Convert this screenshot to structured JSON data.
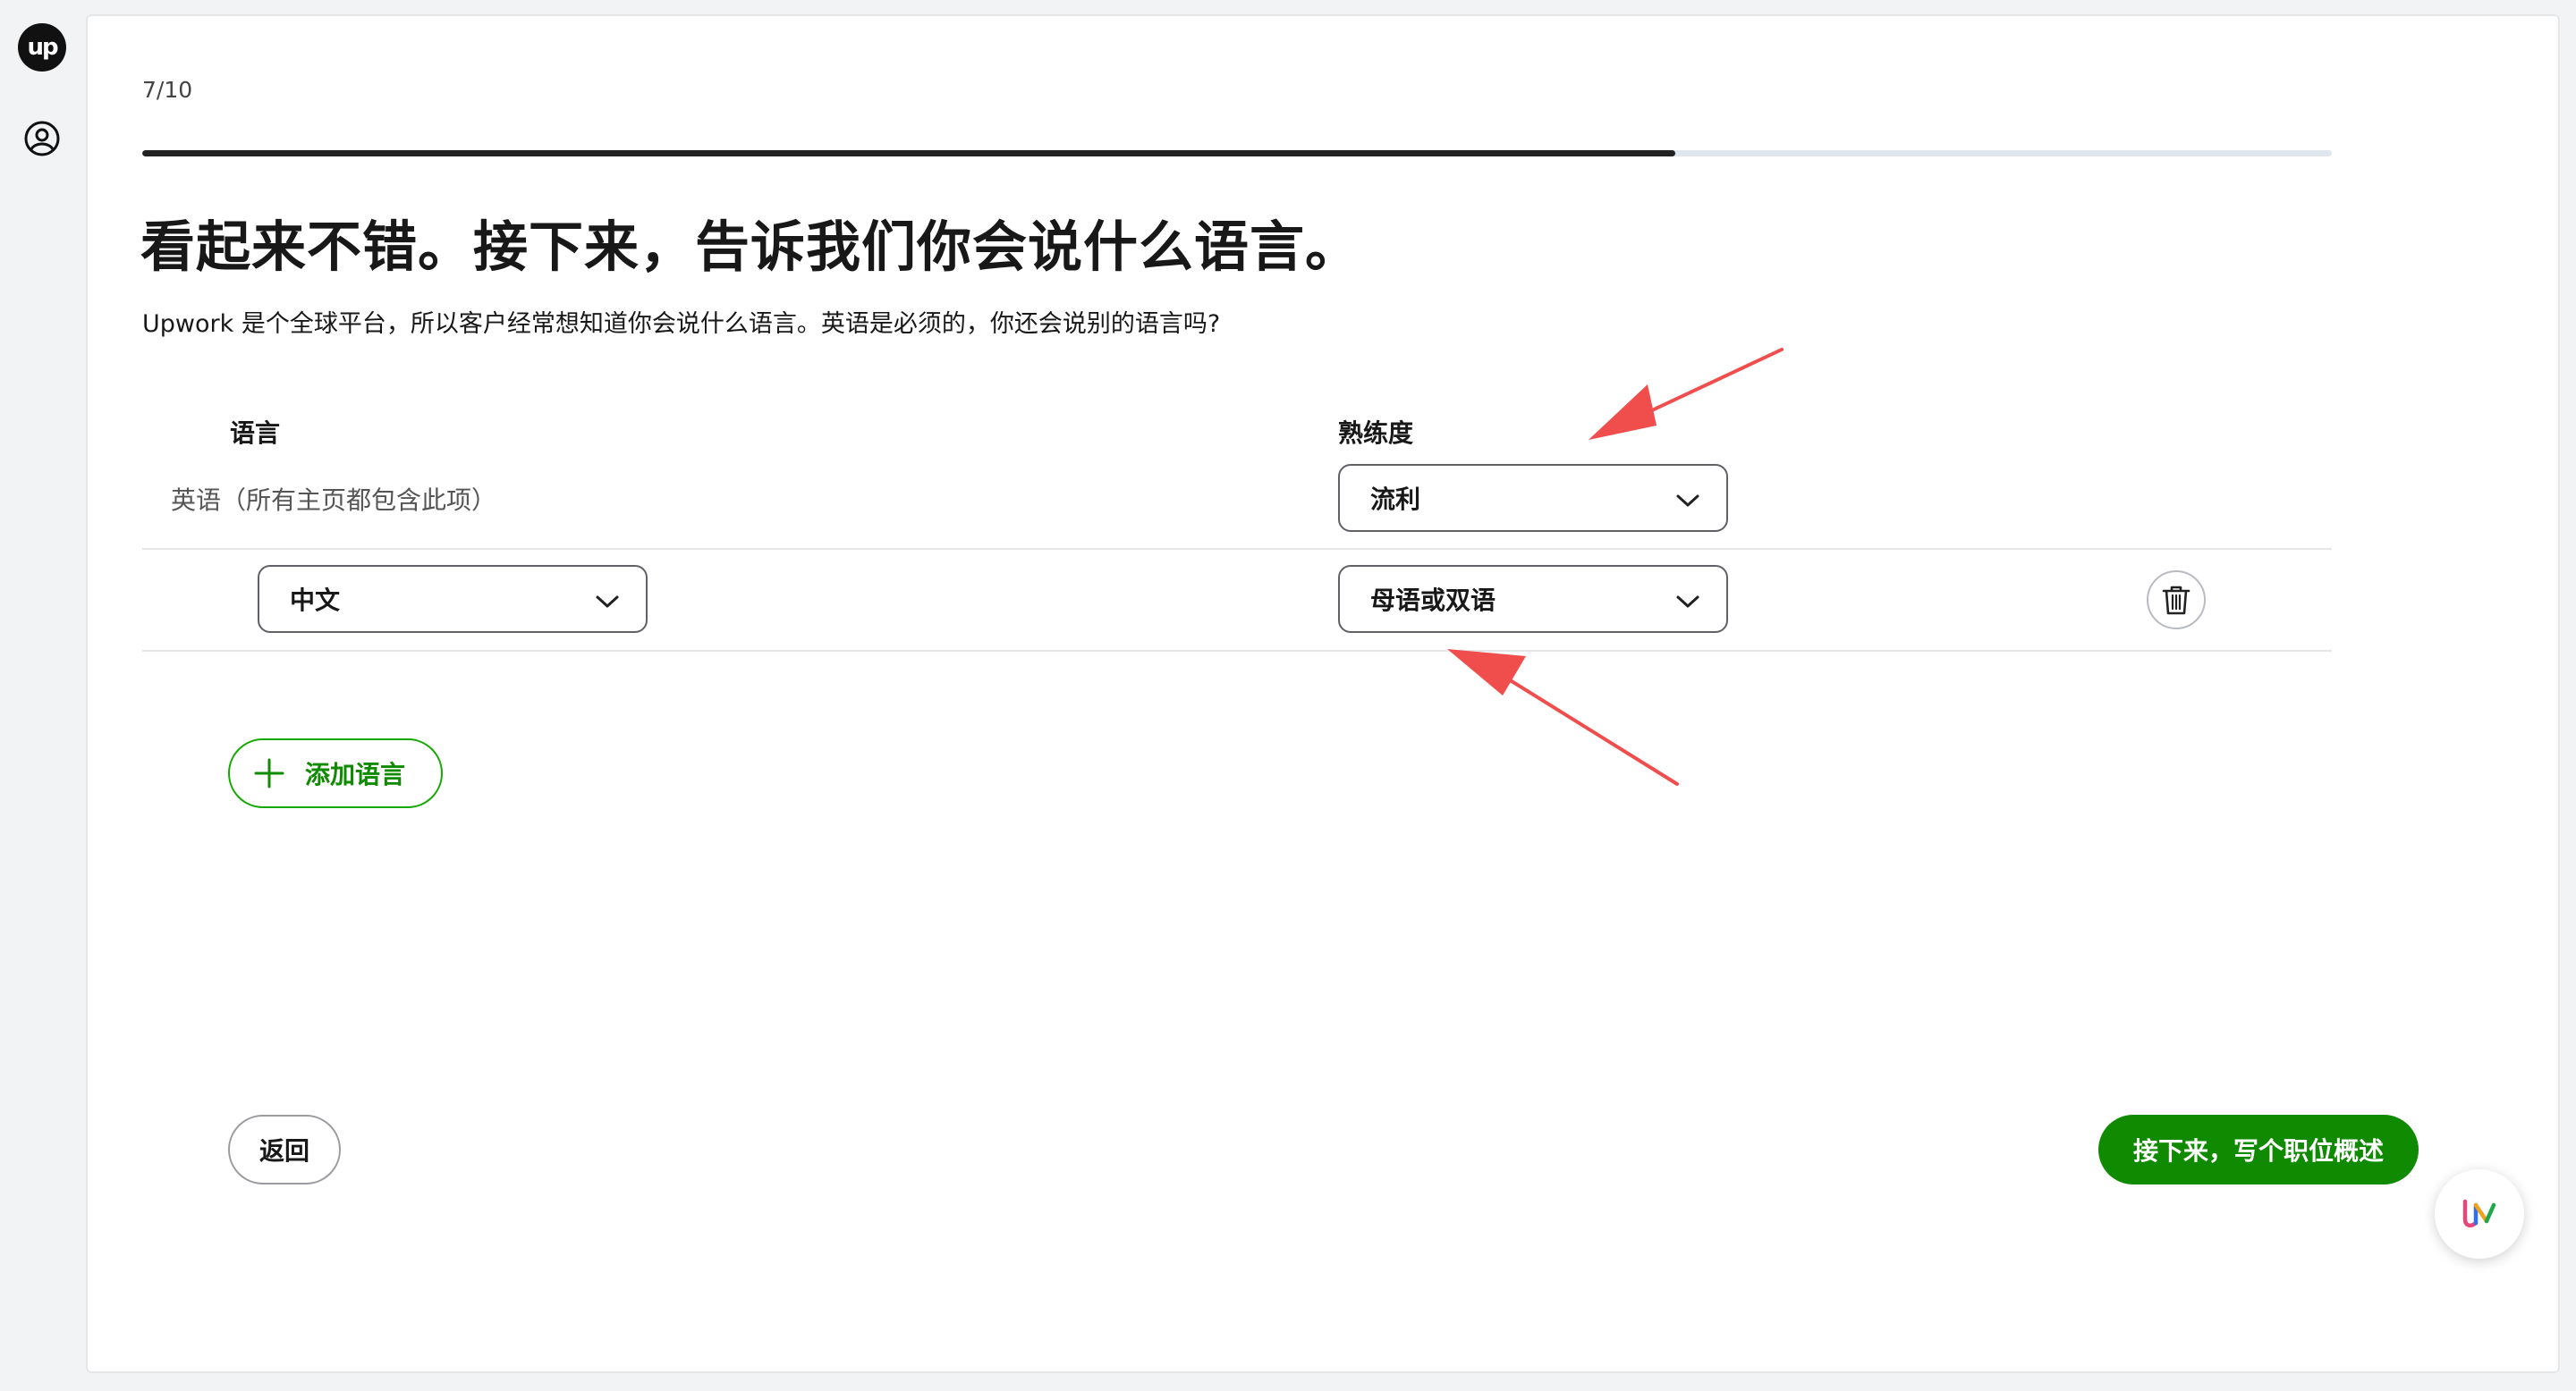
{
  "brand": {
    "logo_text": "up"
  },
  "progress": {
    "step_text": "7/10",
    "fraction": 0.7
  },
  "page": {
    "headline": "看起来不错。接下来，告诉我们你会说什么语言。",
    "subtitle": "Upwork 是个全球平台，所以客户经常想知道你会说什么语言。英语是必须的，你还会说别的语言吗?"
  },
  "languages": {
    "col_language": "语言",
    "col_proficiency": "熟练度",
    "rows": [
      {
        "language": "英语（所有主页都包含此项）",
        "proficiency": "流利",
        "language_editable": false
      },
      {
        "language": "中文",
        "proficiency": "母语或双语",
        "language_editable": true
      }
    ],
    "add_label": "添加语言"
  },
  "footer": {
    "back_label": "返回",
    "next_label": "接下来，写个职位概述"
  },
  "colors": {
    "accent_green": "#108a00",
    "annotation_arrow": "#f04d4d",
    "progress_fill": "#222222"
  },
  "icons": [
    "profile-icon",
    "chevron-down-icon",
    "trash-icon",
    "plus-icon",
    "assistant-icon"
  ]
}
